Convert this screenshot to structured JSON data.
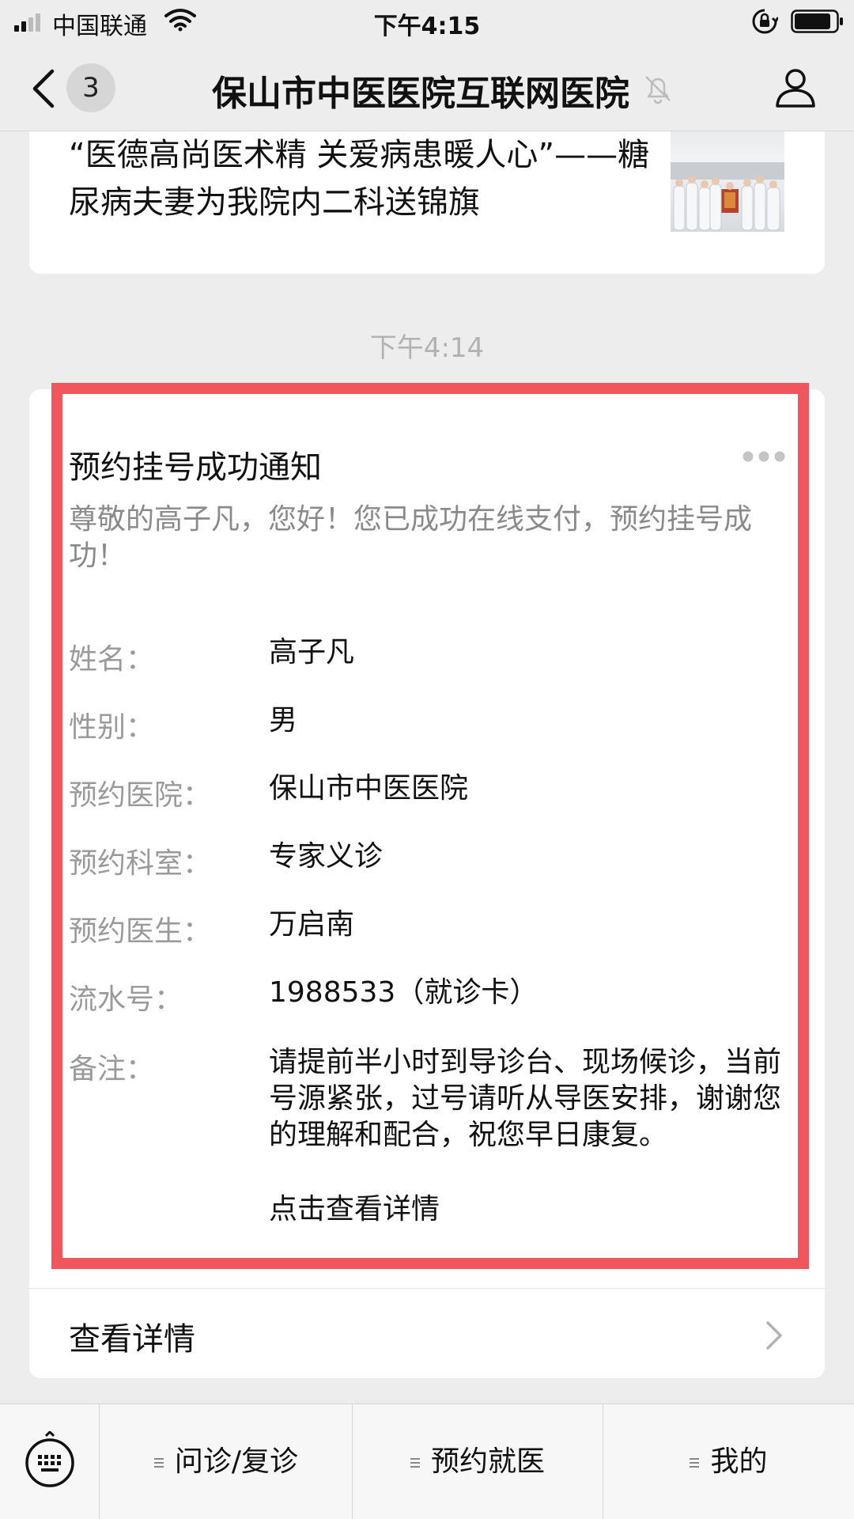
{
  "status_bar": {
    "carrier": "中国联通",
    "time": "下午4:15",
    "signal_icon": "signal-bars-icon",
    "wifi_icon": "wifi-icon",
    "orientation_lock_icon": "orientation-lock-icon",
    "battery_icon": "battery-icon"
  },
  "nav": {
    "back_icon": "chevron-left-icon",
    "unread_count": "3",
    "title": "保山市中医医院互联网医院",
    "mute_icon": "bell-muted-icon",
    "profile_icon": "person-icon"
  },
  "article": {
    "title": "“医德高尚医术精 关爱病患暖人心”——糖尿病夫妻为我院内二科送锦旗"
  },
  "timestamp": "下午4:14",
  "message": {
    "title": "预约挂号成功通知",
    "greeting": "尊敬的高子凡，您好！您已成功在线支付，预约挂号成功！",
    "fields": [
      {
        "label": "姓名：",
        "value": "高子凡"
      },
      {
        "label": "性别：",
        "value": "男"
      },
      {
        "label": "预约医院：",
        "value": "保山市中医医院"
      },
      {
        "label": "预约科室：",
        "value": "专家义诊"
      },
      {
        "label": "预约医生：",
        "value": "万启南"
      },
      {
        "label": "流水号：",
        "value": "1988533（就诊卡）"
      },
      {
        "label": "备注：",
        "value": "请提前半小时到导诊台、现场候诊，当前号源紧张，过号请听从导医安排，谢谢您的理解和配合，祝您早日康复。"
      }
    ],
    "click_hint": "点击查看详情",
    "view_detail": "查看详情",
    "highlight_color": "#f2565d"
  },
  "menu": {
    "keyboard_icon": "keyboard-icon",
    "items": [
      {
        "label": "问诊/复诊"
      },
      {
        "label": "预约就医"
      },
      {
        "label": "我的"
      }
    ]
  }
}
